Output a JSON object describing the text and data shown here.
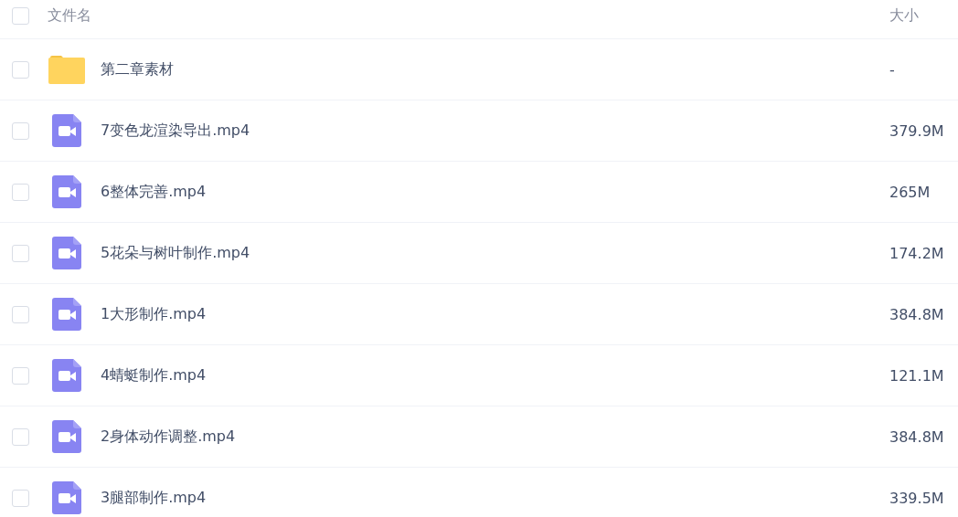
{
  "header": {
    "select_all": {
      "checked": false
    },
    "name_label": "文件名",
    "size_label": "大小"
  },
  "files": [
    {
      "kind": "folder",
      "name": "第二章素材",
      "size": "-",
      "checked": false
    },
    {
      "kind": "video",
      "name": "7变色龙渲染导出.mp4",
      "size": "379.9M",
      "checked": false
    },
    {
      "kind": "video",
      "name": "6整体完善.mp4",
      "size": "265M",
      "checked": false
    },
    {
      "kind": "video",
      "name": "5花朵与树叶制作.mp4",
      "size": "174.2M",
      "checked": false
    },
    {
      "kind": "video",
      "name": "1大形制作.mp4",
      "size": "384.8M",
      "checked": false
    },
    {
      "kind": "video",
      "name": "4蜻蜓制作.mp4",
      "size": "121.1M",
      "checked": false
    },
    {
      "kind": "video",
      "name": "2身体动作调整.mp4",
      "size": "384.8M",
      "checked": false
    },
    {
      "kind": "video",
      "name": "3腿部制作.mp4",
      "size": "339.5M",
      "checked": false
    }
  ]
}
